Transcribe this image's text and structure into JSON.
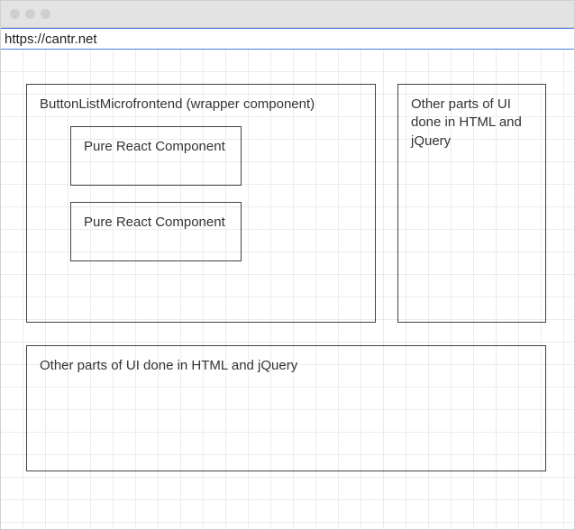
{
  "browser": {
    "url": "https://cantr.net"
  },
  "wrapper": {
    "title": "ButtonListMicrofrontend (wrapper component)",
    "child1": "Pure React Component",
    "child2": "Pure React Component"
  },
  "rightPanel": {
    "text": "Other parts of UI done in HTML and jQuery"
  },
  "bottomPanel": {
    "text": "Other parts of UI done in HTML and jQuery"
  }
}
